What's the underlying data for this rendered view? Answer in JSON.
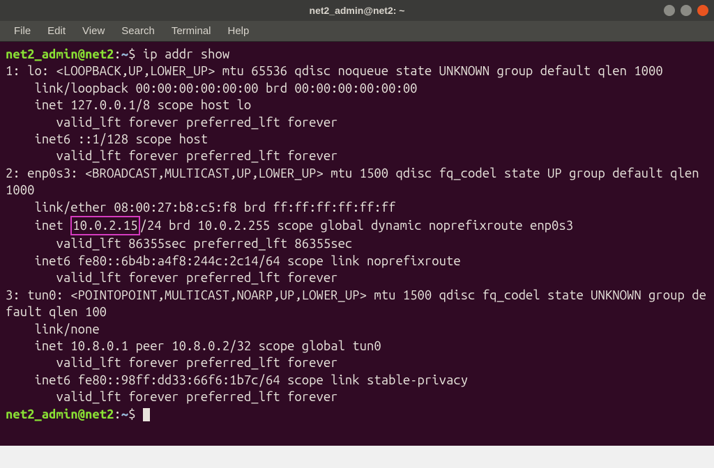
{
  "titlebar": {
    "text": "net2_admin@net2: ~"
  },
  "menubar": {
    "items": [
      "File",
      "Edit",
      "View",
      "Search",
      "Terminal",
      "Help"
    ]
  },
  "prompt": {
    "userhost": "net2_admin@net2",
    "sep": ":",
    "path": "~",
    "dollar": "$ "
  },
  "command1": "ip addr show",
  "output_lines": [
    "1: lo: <LOOPBACK,UP,LOWER_UP> mtu 65536 qdisc noqueue state UNKNOWN group default qlen 1000",
    "    link/loopback 00:00:00:00:00:00 brd 00:00:00:00:00:00",
    "    inet 127.0.0.1/8 scope host lo",
    "       valid_lft forever preferred_lft forever",
    "    inet6 ::1/128 scope host",
    "       valid_lft forever preferred_lft forever",
    "2: enp0s3: <BROADCAST,MULTICAST,UP,LOWER_UP> mtu 1500 qdisc fq_codel state UP group default qlen 1000",
    "    link/ether 08:00:27:b8:c5:f8 brd ff:ff:ff:ff:ff:ff"
  ],
  "inet_line": {
    "pre": "    inet ",
    "boxed": "10.0.2.15",
    "post": "/24 brd 10.0.2.255 scope global dynamic noprefixroute enp0s3"
  },
  "output_lines2": [
    "       valid_lft 86355sec preferred_lft 86355sec",
    "    inet6 fe80::6b4b:a4f8:244c:2c14/64 scope link noprefixroute",
    "       valid_lft forever preferred_lft forever",
    "3: tun0: <POINTOPOINT,MULTICAST,NOARP,UP,LOWER_UP> mtu 1500 qdisc fq_codel state UNKNOWN group default qlen 100",
    "    link/none",
    "    inet 10.8.0.1 peer 10.8.0.2/32 scope global tun0",
    "       valid_lft forever preferred_lft forever",
    "    inet6 fe80::98ff:dd33:66f6:1b7c/64 scope link stable-privacy",
    "       valid_lft forever preferred_lft forever"
  ]
}
